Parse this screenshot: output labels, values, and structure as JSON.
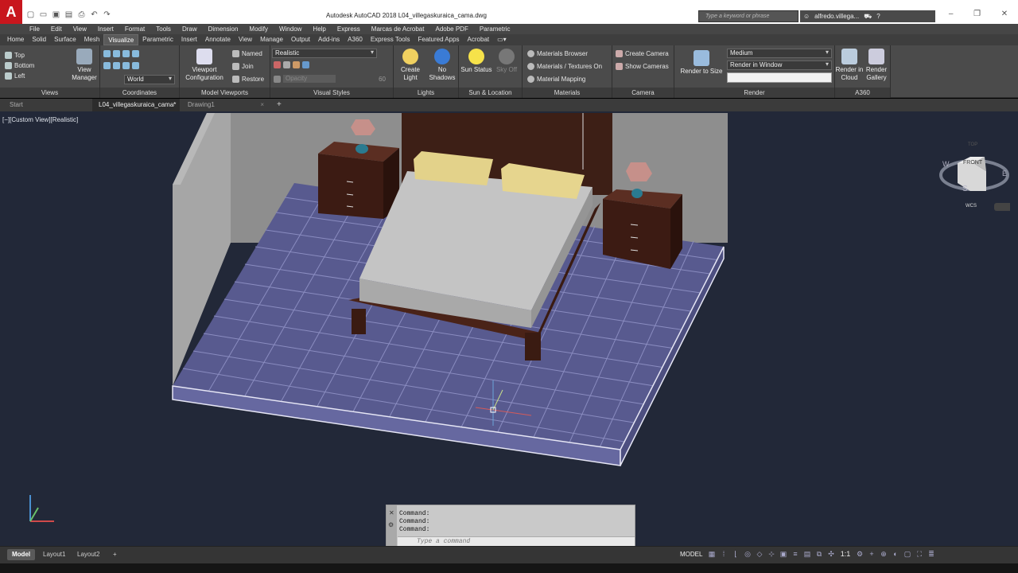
{
  "app": {
    "logo": "A",
    "title": "Autodesk AutoCAD 2018   L04_villegaskuraica_cama.dwg",
    "search_placeholder": "Type a keyword or phrase",
    "user": "alfredo.villega..."
  },
  "menu": [
    "File",
    "Edit",
    "View",
    "Insert",
    "Format",
    "Tools",
    "Draw",
    "Dimension",
    "Modify",
    "Window",
    "Help",
    "Express",
    "Marcas de Acrobat",
    "Adobe PDF",
    "Parametric"
  ],
  "ribbon_tabs": [
    "Home",
    "Solid",
    "Surface",
    "Mesh",
    "Visualize",
    "Parametric",
    "Insert",
    "Annotate",
    "View",
    "Manage",
    "Output",
    "Add-ins",
    "A360",
    "Express Tools",
    "Featured Apps",
    "Acrobat"
  ],
  "ribbon_active_tab": "Visualize",
  "ribbon": {
    "views": {
      "title": "Views",
      "items": [
        "Top",
        "Bottom",
        "Left"
      ],
      "manager": "View Manager"
    },
    "coordinates": {
      "title": "Coordinates",
      "world": "World"
    },
    "model_viewports": {
      "title": "Model Viewports",
      "config": "Viewport Configuration",
      "named": "Named",
      "join": "Join",
      "restore": "Restore"
    },
    "visual_styles": {
      "title": "Visual Styles",
      "style": "Realistic",
      "opacity_label": "Opacity",
      "opacity_value": "60"
    },
    "lights": {
      "title": "Lights",
      "create": "Create Light",
      "shadows": "No Shadows"
    },
    "sun": {
      "title": "Sun & Location",
      "status": "Sun Status",
      "sky": "Sky Off"
    },
    "materials": {
      "title": "Materials",
      "browser": "Materials Browser",
      "textures": "Materials / Textures On",
      "mapping": "Material Mapping"
    },
    "camera": {
      "title": "Camera",
      "create": "Create Camera",
      "show": "Show Cameras"
    },
    "render": {
      "title": "Render",
      "to_size": "Render to Size",
      "quality": "Medium",
      "target": "Render in Window"
    },
    "a360": {
      "title": "A360",
      "cloud": "Render in Cloud",
      "gallery": "Render Gallery"
    }
  },
  "file_tabs": [
    {
      "label": "Start",
      "active": false
    },
    {
      "label": "L04_villegaskuraica_cama*",
      "active": true
    },
    {
      "label": "Drawing1",
      "active": false
    }
  ],
  "viewport": {
    "label": "[−][Custom View][Realistic]",
    "viewcube": {
      "top": "TOP",
      "front": "FRONT",
      "n": "W",
      "e": "E",
      "s": "S",
      "wcs": "WCS"
    }
  },
  "command": {
    "history": [
      "Command:",
      "Command:",
      "Command:"
    ],
    "placeholder": "Type a command"
  },
  "layout_tabs": [
    "Model",
    "Layout1",
    "Layout2"
  ],
  "status": {
    "space": "MODEL",
    "scale": "1:1"
  },
  "colors": {
    "viewport_bg": "#222838",
    "floor": "#585a8f",
    "bed_wood": "#4a2318",
    "mattress": "#bdbdbd",
    "pillow": "#e6d58e"
  }
}
